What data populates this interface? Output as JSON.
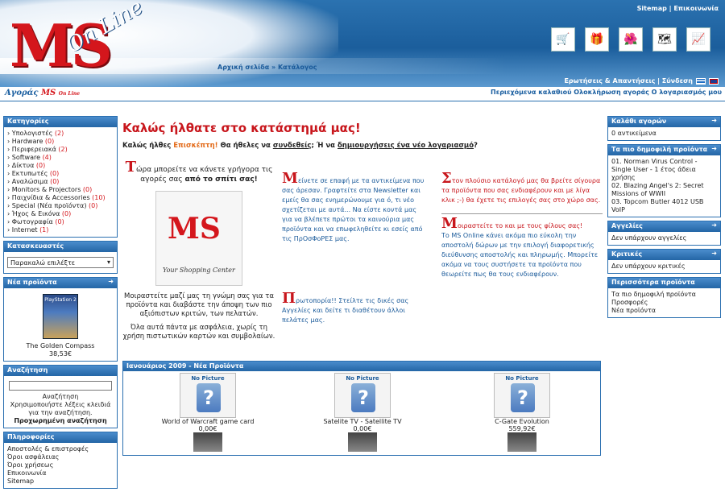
{
  "header": {
    "top_links": [
      "Sitemap",
      "Επικοινωνία"
    ],
    "breadcrumb": "Αρχική σελίδα » Κατάλογος",
    "subnav": "Ερωτήσεις & Απαντήσεις | Σύνδεση",
    "logo_text": "MS",
    "logo_script": "On Line",
    "tagline_prefix": "Αγοράς",
    "tagline_brand": "MS",
    "tagline_suffix": "On Line",
    "cart_links": "Περιεχόμενα καλαθιού  Ολοκλήρωση αγοράς  Ο λογαριασμός μου"
  },
  "left": {
    "categories_title": "Κατηγορίες",
    "categories": [
      {
        "name": "Υπολογιστές",
        "count": "(2)"
      },
      {
        "name": "Hardware",
        "count": "(0)"
      },
      {
        "name": "Περιφερειακά",
        "count": "(2)"
      },
      {
        "name": "Software",
        "count": "(4)"
      },
      {
        "name": "Δίκτυα",
        "count": "(0)"
      },
      {
        "name": "Εκτυπωτές",
        "count": "(0)"
      },
      {
        "name": "Αναλώσιμα",
        "count": "(0)"
      },
      {
        "name": "Monitors & Projectors",
        "count": "(0)"
      },
      {
        "name": "Παιχνίδια & Accessories",
        "count": "(10)"
      },
      {
        "name": "Special (Νέα προϊόντα)",
        "count": "(0)"
      },
      {
        "name": "Ήχος & Εικόνα",
        "count": "(0)"
      },
      {
        "name": "Φωτογραφία",
        "count": "(0)"
      },
      {
        "name": "Internet",
        "count": "(1)"
      }
    ],
    "manufacturers_title": "Κατασκευαστές",
    "manufacturers_select": "Παρακαλώ επιλέξτε",
    "new_products_title": "Νέα προϊόντα",
    "new_product_name": "The Golden Compass",
    "new_product_price": "38,53€",
    "new_product_platform": "PlayStation 2",
    "search_title": "Αναζήτηση",
    "search_label": "Αναζήτηση",
    "search_hint": "Χρησιμοποιήστε λέξεις κλειδιά για την αναζήτηση.",
    "advanced_search": "Προχωρημένη αναζήτηση",
    "info_title": "Πληροφορίες",
    "info_links": [
      "Αποστολές & επιστροφές",
      "Όροι ασφάλειας",
      "Όροι χρήσεως",
      "Επικοινωνία",
      "Sitemap"
    ]
  },
  "main": {
    "title": "Καλώς ήλθατε στο κατάστημά μας!",
    "welcome_prefix": "Καλώς ήλθες ",
    "welcome_guest": "Επισκέπτη!",
    "welcome_mid": " Θα ήθελες να ",
    "welcome_login": "συνδεθείς",
    "welcome_or": "; Ή να ",
    "welcome_create": "δημιουργήσεις ένα νέο λογαριασμό",
    "welcome_end": "?",
    "col1_big": "Τ",
    "col1_text": "ώρα μπορείτε να κάνετε γρήγορα τις αγορές σας ",
    "col1_bold": "από το σπίτι σας!",
    "bag_logo": "MS",
    "bag_caption": "Your Shopping Center",
    "col1_share": "Μοιραστείτε μαζί μας τη γνώμη σας για τα προϊόντα και διαβάστε την άποψη των πιο αξιόπιστων κριτών, των πελατών.",
    "col1_safe": "Όλα αυτά πάντα με ασφάλεια, χωρίς τη χρήση πιστωτικών καρτών και συμβολαίων.",
    "col2_big": "Μ",
    "col2_text": "είνετε σε επαφή με τα αντικείμενα που σας άρεσαν. Γραφτείτε στα Newsletter και εμείς θα σας ενημερώνουμε για ό, τι νέο σχετίζεται με αυτά... Να είστε κοντά μας για να βλέπετε πρώτοι τα καινούρια μας προϊόντα και να επωφεληθείτε κι εσείς από τις ΠρΟσΦοΡΕΣ μας.",
    "col2b_big": "Π",
    "col2b_text": "ρωτοπορία!! Στείλτε τις δικές σας Αγγελίες και δείτε τι διαθέτουν άλλοι πελάτες μας.",
    "col3_big": "Σ",
    "col3_text": "τον πλούσιο κατάλογό μας θα βρείτε σίγουρα τα προϊόντα που σας ενδιαφέρουν και με λίγα κλικ ;-) θα έχετε τις επιλογές σας στο χώρο σας.",
    "col3b_big": "Μ",
    "col3b_title": "οιραστείτε το και με τους φίλους σας!",
    "col3b_text": "Το MS Online κάνει ακόμα πιο εύκολη την αποστολή δώρων με την επιλογή διαφορετικής διεύθυνσης αποστολής και πληρωμής. Μπορείτε ακόμα να τους συστήσετε τα προϊόντα που θεωρείτε πως θα τους ενδιαφέρουν.",
    "newprods_title": "Ιανουάριος 2009 - Νέα Προϊόντα",
    "no_picture": "No Picture",
    "products": [
      {
        "name": "World of Warcraft game card",
        "price": "0,00€"
      },
      {
        "name": "Satelite TV - Satellite TV",
        "price": "0,00€"
      },
      {
        "name": "C-Gate Evolution",
        "price": "559,92€"
      }
    ]
  },
  "right": {
    "cart_title": "Καλάθι αγορών",
    "cart_text": "0 αντικείμενα",
    "popular_title": "Τα πιο δημοφιλή προϊόντα",
    "popular": [
      "01. Norman Virus Control - Single User - 1 έτος άδεια χρήσης",
      "02. Blazing Angel's 2: Secret Missions of WWII",
      "03. Topcom Butler 4012 USB VoIP"
    ],
    "ads_title": "Αγγελίες",
    "ads_text": "Δεν υπάρχουν αγγελίες",
    "reviews_title": "Κριτικές",
    "reviews_text": "Δεν υπάρχουν κριτικές",
    "more_title": "Περισσότερα προϊόντα",
    "more_links": [
      "Τα πιο δημοφιλή προϊόντα",
      "Προσφορές",
      "Νέα προϊόντα"
    ]
  },
  "colors": {
    "brand_red": "#d4161c",
    "brand_blue": "#2466a6"
  }
}
